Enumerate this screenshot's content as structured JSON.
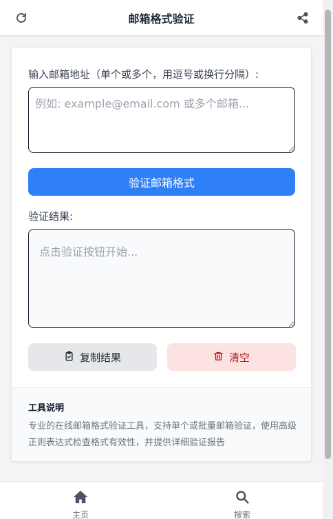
{
  "header": {
    "title": "邮箱格式验证",
    "refresh_icon": "refresh-icon",
    "share_icon": "share-icon"
  },
  "form": {
    "input_label": "输入邮箱地址（单个或多个，用逗号或换行分隔）:",
    "input_placeholder": "例如: example@email.com 或多个邮箱...",
    "input_value": "",
    "verify_button": "验证邮箱格式",
    "result_label": "验证结果:",
    "result_placeholder": "点击验证按钮开始...",
    "result_value": "",
    "copy_button": "复制结果",
    "clear_button": "清空"
  },
  "info": {
    "title": "工具说明",
    "text": "专业的在线邮箱格式验证工具，支持单个或批量邮箱验证，使用高级正则表达式检查格式有效性，并提供详细验证报告"
  },
  "nav": {
    "home": "主页",
    "search": "搜索"
  },
  "colors": {
    "primary": "#2f80f7",
    "danger_bg": "#fde2e2",
    "danger_text": "#b91c1c",
    "neutral_bg": "#e5e7eb"
  }
}
